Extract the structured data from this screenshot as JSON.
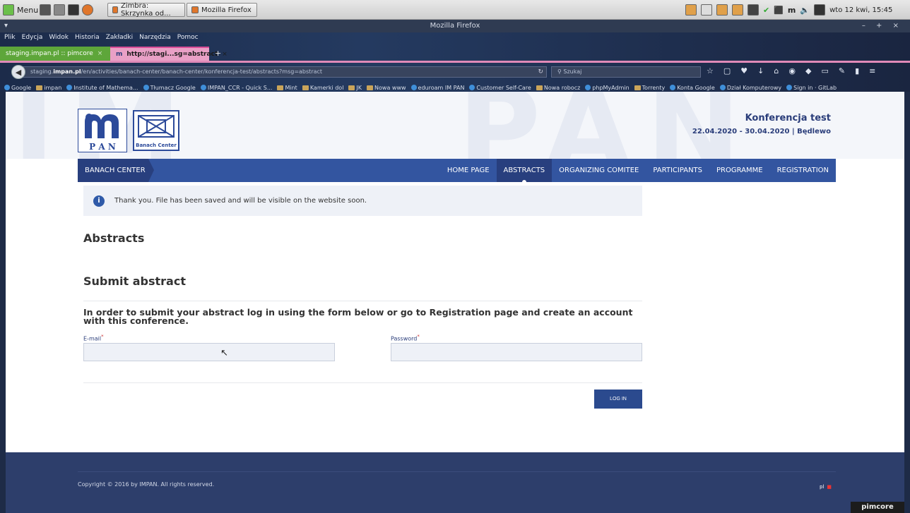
{
  "panel": {
    "menu_label": "Menu",
    "tasks": [
      "Zimbra: Skrzynka od...",
      "Mozilla Firefox"
    ],
    "clock": "wto 12 kwi, 15:45",
    "indicator": "m"
  },
  "window": {
    "title": "Mozilla Firefox",
    "controls": "– + ×"
  },
  "menubar": [
    "Plik",
    "Edycja",
    "Widok",
    "Historia",
    "Zakładki",
    "Narzędzia",
    "Pomoc"
  ],
  "tabs": [
    "staging.impan.pl :: pimcore",
    "http://stagi...sg=abstract"
  ],
  "url": {
    "prefix": "staging.",
    "host": "impan.pl",
    "path": "/en/activities/banach-center/banach-center/konferencja-test/abstracts?msg=abstract"
  },
  "search_placeholder": "Szukaj",
  "bookmarks": [
    "Google",
    "impan",
    "Institute of Mathema...",
    "Tłumacz Google",
    "IMPAN_CCR - Quick S...",
    "Mint",
    "Kamerki dol",
    "JK",
    "Nowa www",
    "eduroam IM PAN",
    "Customer Self-Care",
    "Nowa robocz",
    "phpMyAdmin",
    "Torrenty",
    "Konta Google",
    "Dział Komputerowy",
    "Sign in · GitLab"
  ],
  "site": {
    "conference_title": "Konferencja test",
    "conference_dates": "22.04.2020 - 30.04.2020 | Będlewo",
    "logo_text": "Banach Center",
    "logo_m_letters": "P A N",
    "brand": "BANACH CENTER",
    "nav": [
      "HOME PAGE",
      "ABSTRACTS",
      "ORGANIZING COMITEE",
      "PARTICIPANTS",
      "PROGRAMME",
      "REGISTRATION"
    ],
    "active_nav": "ABSTRACTS",
    "alert": "Thank you. File has been saved and will be visible on the website soon.",
    "heading": "Abstracts",
    "subheading": "Submit abstract",
    "instructions": "In order to submit your abstract log in using the form below or go to Registration page and create an account with this conference.",
    "email_label": "E-mail",
    "password_label": "Password",
    "login_button": "LOG IN",
    "copyright": "Copyright © 2016 by IMPAN. All rights reserved.",
    "lang": "pl",
    "footer_badge": "pimcore"
  },
  "colors": {
    "navbar": "#3355a0",
    "navbar_active": "#283f7e",
    "footer": "#2d3e6b",
    "accent": "#2a3d7a"
  }
}
